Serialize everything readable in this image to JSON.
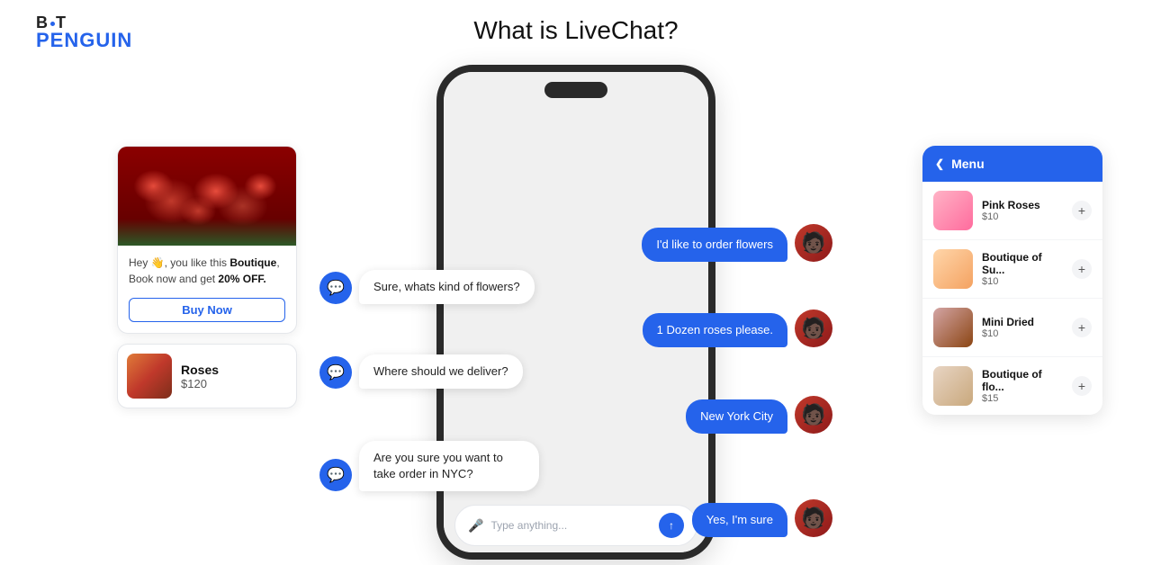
{
  "header": {
    "logo_bot": "BoT",
    "logo_penguin": "PENGUIN",
    "page_title": "What is LiveChat?"
  },
  "left_card": {
    "description": "Hey 👋, you like this ",
    "highlight": "Boutique",
    "subtext": "Book now and get ",
    "discount": "20% OFF.",
    "buy_button": "Buy Now"
  },
  "product": {
    "name": "Roses",
    "price": "$120"
  },
  "chat_input": {
    "placeholder": "Type anything..."
  },
  "chat_bubbles": {
    "b1": "I'd like to order flowers",
    "b2": "Sure, whats kind of flowers?",
    "b3": "1 Dozen roses please.",
    "b4": "Where should we deliver?",
    "b5": "New York City",
    "b6": "Are you sure you want to take order in NYC?",
    "b7": "Yes, I'm sure"
  },
  "menu": {
    "title": "Menu",
    "items": [
      {
        "name": "Pink Roses",
        "price": "$10",
        "img_class": "pink"
      },
      {
        "name": "Boutique of Su...",
        "price": "$10",
        "img_class": "boutique"
      },
      {
        "name": "Mini Dried",
        "price": "$10",
        "img_class": "mini"
      },
      {
        "name": "Boutique of flo...",
        "price": "$15",
        "img_class": "boutique2"
      }
    ]
  }
}
